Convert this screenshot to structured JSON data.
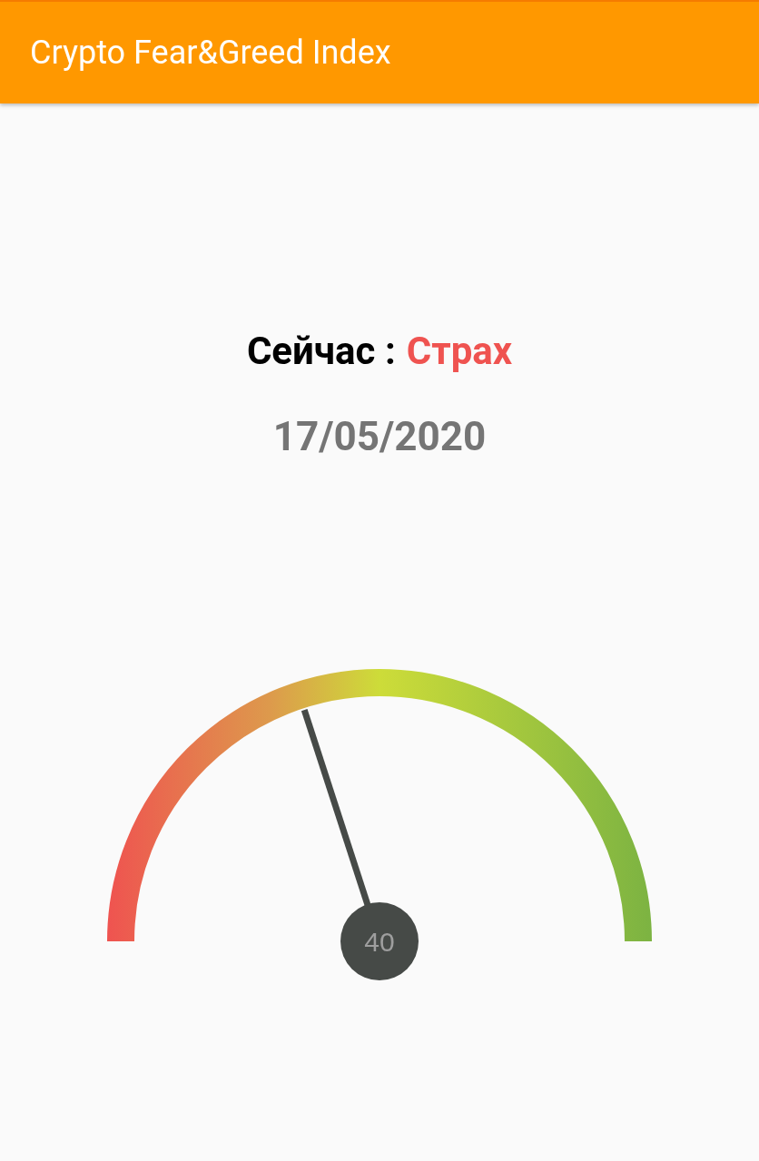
{
  "app_bar": {
    "title": "Crypto Fear&Greed Index"
  },
  "status": {
    "label": "Сейчас :",
    "value": "Страх",
    "color": "#ef5350"
  },
  "date": "17/05/2020",
  "gauge": {
    "level": 0.4,
    "reading": "40"
  }
}
